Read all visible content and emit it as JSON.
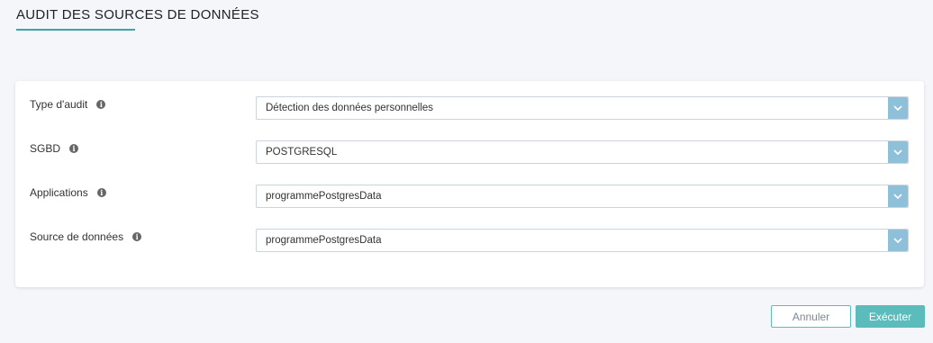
{
  "page": {
    "title": "AUDIT DES SOURCES DE DONNÉES"
  },
  "form": {
    "fields": [
      {
        "label": "Type d'audit",
        "value": "Détection des données personnelles"
      },
      {
        "label": "SGBD",
        "value": "POSTGRESQL"
      },
      {
        "label": "Applications",
        "value": "programmePostgresData"
      },
      {
        "label": "Source de données",
        "value": "programmePostgresData"
      }
    ]
  },
  "actions": {
    "cancel_label": "Annuler",
    "execute_label": "Exécuter"
  },
  "colors": {
    "accent": "#5cbcbc",
    "dropdown_toggle": "#8fc0da",
    "info_icon": "#666666"
  },
  "icons": {
    "info": "info-icon",
    "dropdown": "chevron-down-icon"
  }
}
